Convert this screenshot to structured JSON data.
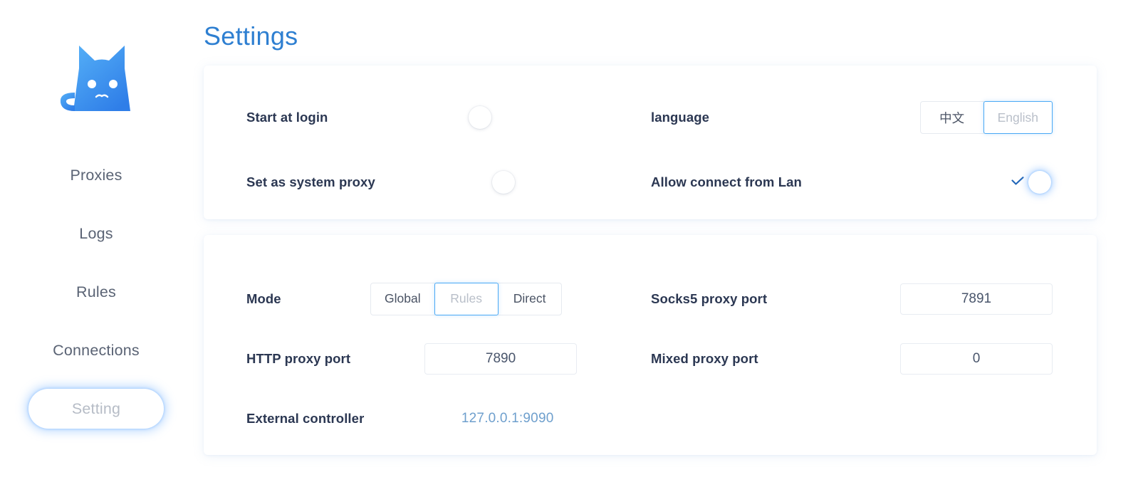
{
  "app": {
    "logo_icon": "clash-cat-logo-icon",
    "logo_gradient_from": "#4aa9f5",
    "logo_gradient_to": "#2f7ee8"
  },
  "sidebar": {
    "items": [
      {
        "label": "Proxies",
        "active": false
      },
      {
        "label": "Logs",
        "active": false
      },
      {
        "label": "Rules",
        "active": false
      },
      {
        "label": "Connections",
        "active": false
      },
      {
        "label": "Setting",
        "active": true
      }
    ]
  },
  "header": {
    "title": "Settings",
    "title_color": "#2e7fd1"
  },
  "general_card": {
    "start_at_login": {
      "label": "Start at login",
      "state": "off"
    },
    "set_as_system_proxy": {
      "label": "Set as system proxy",
      "state": "off"
    },
    "language": {
      "label": "language",
      "options": [
        "中文",
        "English"
      ],
      "selected": "English"
    },
    "allow_lan": {
      "label": "Allow connect from Lan",
      "state": "on",
      "check_icon": "check-icon"
    }
  },
  "ports_card": {
    "mode": {
      "label": "Mode",
      "options": [
        "Global",
        "Rules",
        "Direct"
      ],
      "selected": "Rules"
    },
    "socks5_port": {
      "label": "Socks5 proxy port",
      "value": "7891",
      "placeholder": "Socks5 proxy port"
    },
    "http_port": {
      "label": "HTTP proxy port",
      "value": "7890",
      "placeholder": "HTTP proxy port"
    },
    "mixed_port": {
      "label": "Mixed proxy port",
      "value": "0",
      "placeholder": "Mixed proxy port"
    },
    "external_controller": {
      "label": "External controller",
      "value": "127.0.0.1:9090"
    }
  },
  "colors": {
    "accent": "#4aa9f5",
    "label": "#2b3752",
    "link": "#6e9fcd",
    "page_bg": "#ffffff"
  }
}
